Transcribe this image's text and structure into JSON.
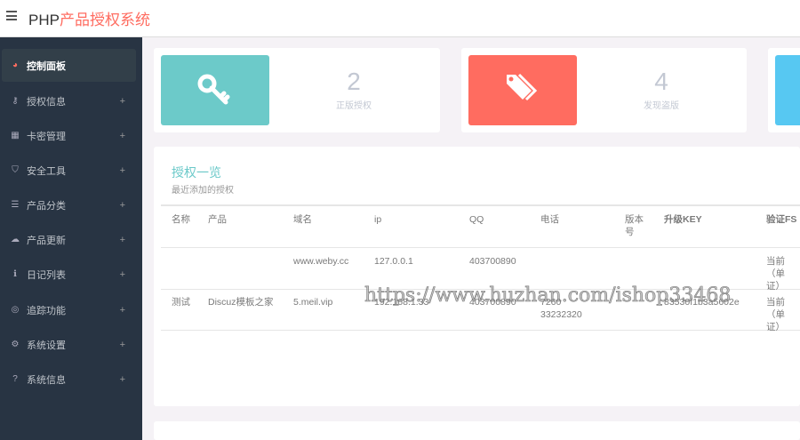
{
  "header": {
    "title_prefix": "PHP",
    "title_main": "产品授权系统"
  },
  "sidebar": {
    "items": [
      {
        "label": "控制面板",
        "icon": "dashboard-icon",
        "glyph": "◕"
      },
      {
        "label": "授权信息",
        "icon": "key-icon",
        "glyph": "⚷",
        "plus": "+"
      },
      {
        "label": "卡密管理",
        "icon": "qrcode-icon",
        "glyph": "▦",
        "plus": "+"
      },
      {
        "label": "安全工具",
        "icon": "shield-icon",
        "glyph": "⛉",
        "plus": "+"
      },
      {
        "label": "产品分类",
        "icon": "list-icon",
        "glyph": "☰",
        "plus": "+"
      },
      {
        "label": "产品更新",
        "icon": "cloud-upload-icon",
        "glyph": "☁",
        "plus": "+"
      },
      {
        "label": "日记列表",
        "icon": "info-icon",
        "glyph": "ℹ",
        "plus": "+"
      },
      {
        "label": "追踪功能",
        "icon": "target-icon",
        "glyph": "◎",
        "plus": "+"
      },
      {
        "label": "系统设置",
        "icon": "gears-icon",
        "glyph": "⚙",
        "plus": "+"
      },
      {
        "label": "系统信息",
        "icon": "question-icon",
        "glyph": "?",
        "plus": "+"
      }
    ]
  },
  "stats": [
    {
      "value": "2",
      "label": "正版授权",
      "color": "#6ccac9",
      "icon": "key-icon"
    },
    {
      "value": "4",
      "label": "发现盗版",
      "color": "#ff6c60",
      "icon": "tags-icon"
    },
    {
      "color": "#57c8f2"
    }
  ],
  "table": {
    "title": "授权一览",
    "subtitle": "最近添加的授权",
    "headers": [
      "名称",
      "产品",
      "域名",
      "ip",
      "QQ",
      "电话",
      "版本号",
      "升级KEY",
      "验证FS"
    ],
    "rows": [
      [
        "",
        "",
        "www.weby.cc",
        "127.0.0.1",
        "403700890",
        "",
        "",
        "",
        "当前（单证）"
      ],
      [
        "测试",
        "Discuz模板之家",
        "5.meil.vip",
        "192.168.1.33",
        "403700890",
        "7260 33232320",
        "",
        "83530f1b3a5602e",
        "当前（单证）"
      ]
    ]
  },
  "watermark": "https://www.huzhan.com/ishop33468"
}
